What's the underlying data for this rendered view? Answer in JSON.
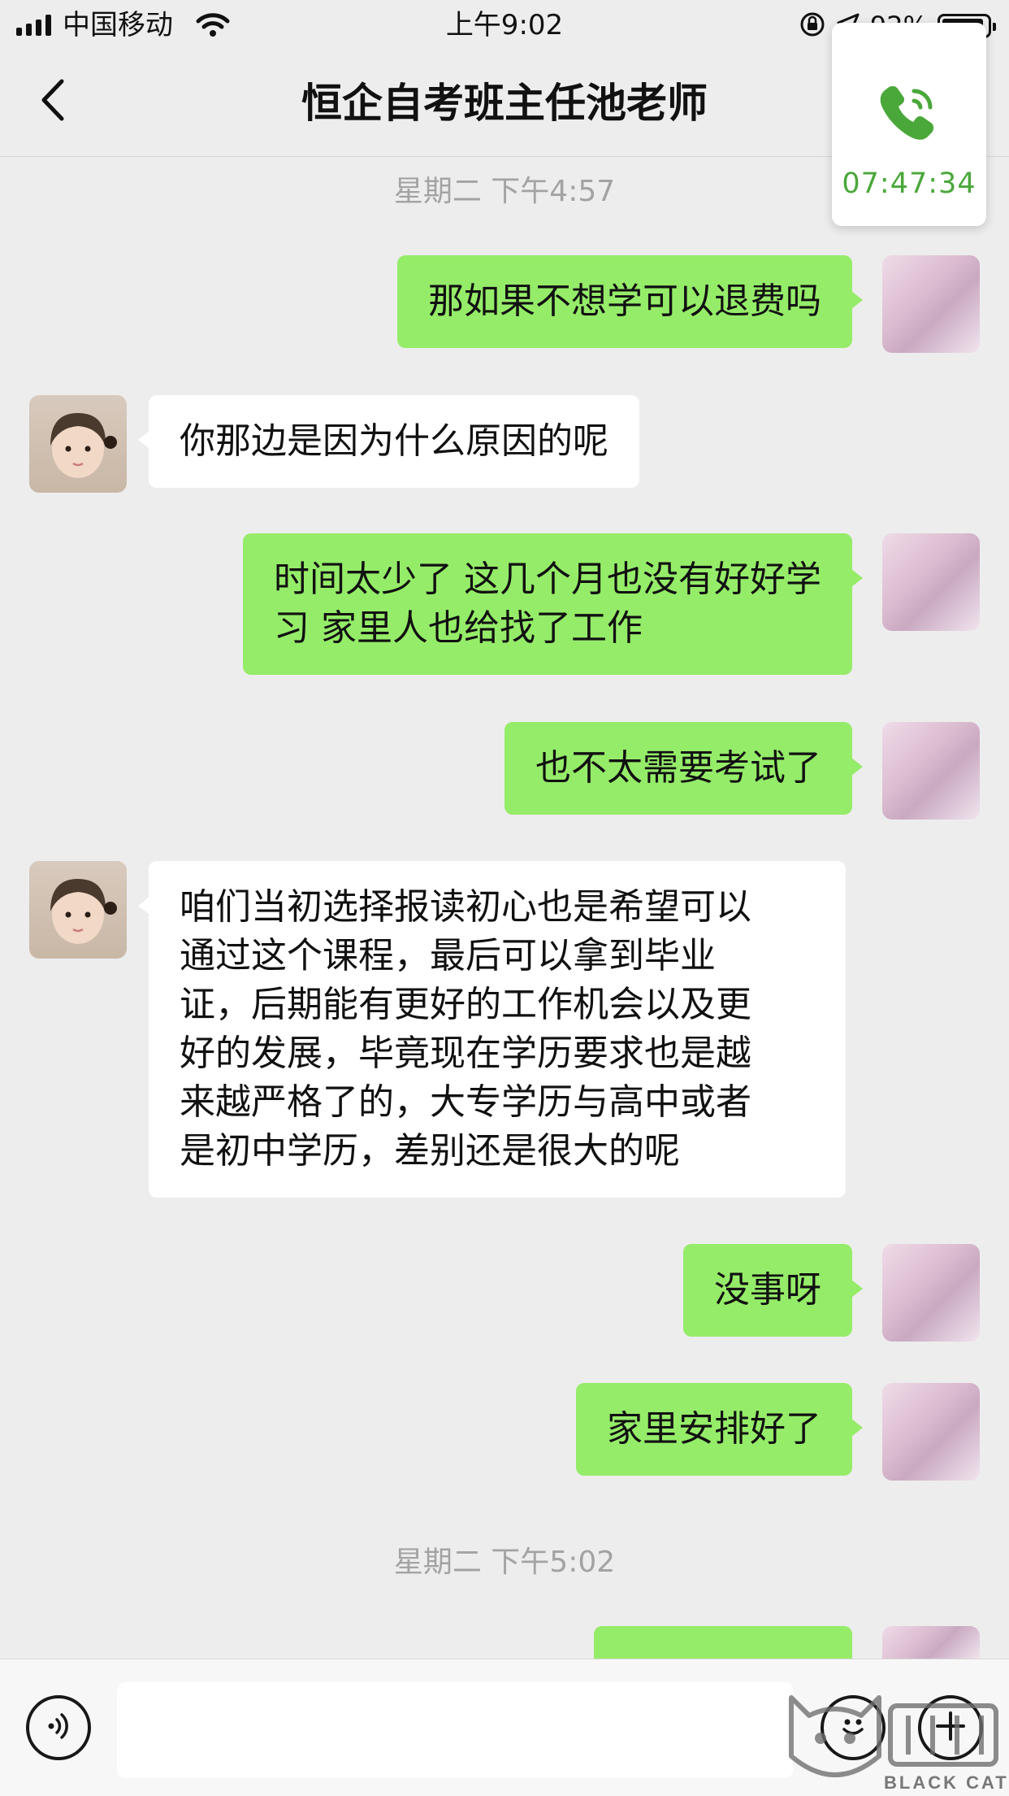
{
  "status_bar": {
    "carrier": "中国移动",
    "time": "上午9:02",
    "battery_pct": "92%",
    "battery_level": 0.92
  },
  "nav": {
    "title": "恒企自考班主任池老师"
  },
  "call_widget": {
    "duration": "07:47:34",
    "color": "#4aa83a"
  },
  "timestamps": [
    "星期二 下午4:57",
    "星期二 下午5:02"
  ],
  "messages": [
    {
      "side": "right",
      "text": "那如果不想学可以退费吗"
    },
    {
      "side": "left",
      "text": "你那边是因为什么原因的呢"
    },
    {
      "side": "right",
      "lines": [
        "时间太少了 这几个月也没有好好学",
        "习 家里人也给找了工作"
      ]
    },
    {
      "side": "right",
      "text": "也不太需要考试了"
    },
    {
      "side": "left",
      "lines": [
        "咱们当初选择报读初心也是希望可以",
        "通过这个课程，最后可以拿到毕业",
        "证，后期能有更好的工作机会以及更",
        "好的发展，毕竟现在学历要求也是越",
        "来越严格了的，大专学历与高中或者",
        "是初中学历，差别还是很大的呢"
      ]
    },
    {
      "side": "right",
      "text": "没事呀"
    },
    {
      "side": "right",
      "text": "家里安排好了"
    }
  ],
  "input": {
    "value": "",
    "placeholder": ""
  },
  "icons": {
    "back": "chevron-left-icon",
    "voice": "voice-icon",
    "emoji": "emoji-icon",
    "plus": "plus-icon",
    "call": "phone-icon"
  },
  "watermark": {
    "mark": "黑猫",
    "text": "BLACK CAT"
  },
  "colors": {
    "bubble_self": "#95ec69",
    "bubble_other": "#ffffff",
    "background": "#ededed"
  }
}
